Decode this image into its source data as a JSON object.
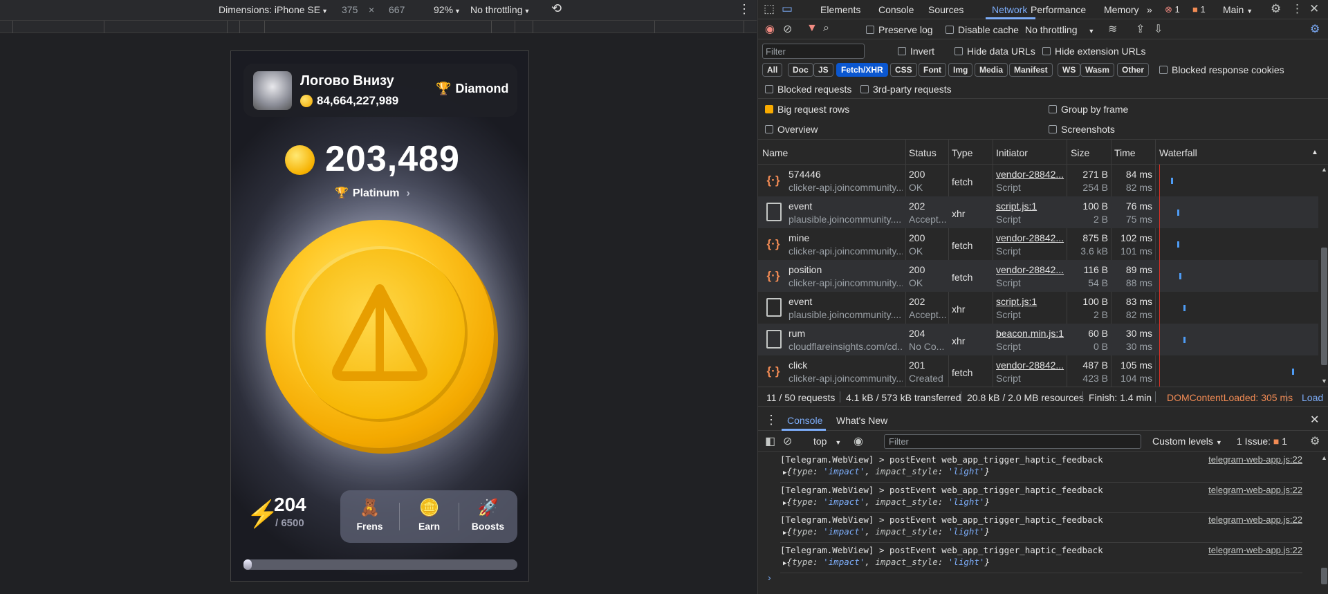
{
  "device_toolbar": {
    "dimensions_label": "Dimensions: iPhone SE",
    "width": "375",
    "times": "×",
    "height": "667",
    "zoom": "92%",
    "throttling": "No throttling"
  },
  "app": {
    "username": "Логово Внизу",
    "balance": "84,664,227,989",
    "tier": "Diamond",
    "score": "203,489",
    "league": "Platinum",
    "energy_current": "204",
    "energy_max": "/ 6500",
    "energy_fraction": 0.031,
    "nav": [
      {
        "label": "Frens",
        "icon": "🧸"
      },
      {
        "label": "Earn",
        "icon": "🪙"
      },
      {
        "label": "Boosts",
        "icon": "🚀"
      }
    ]
  },
  "devtools": {
    "tabs": [
      "Elements",
      "Console",
      "Sources",
      "Network",
      "Performance",
      "Memory"
    ],
    "active_tab": "Network",
    "more": "»",
    "errors": "1",
    "warnings": "1",
    "context": "Main",
    "network_toolbar": {
      "preserve_log": "Preserve log",
      "disable_cache": "Disable cache",
      "throttling": "No throttling"
    },
    "filter": {
      "placeholder": "Filter",
      "invert": "Invert",
      "hide_data_urls": "Hide data URLs",
      "hide_extension_urls": "Hide extension URLs",
      "chips": [
        "All",
        "Doc",
        "JS",
        "Fetch/XHR",
        "CSS",
        "Font",
        "Img",
        "Media",
        "Manifest",
        "WS",
        "Wasm",
        "Other"
      ],
      "active_chip": "Fetch/XHR",
      "blocked_cookies": "Blocked response cookies",
      "blocked_requests": "Blocked requests",
      "third_party": "3rd-party requests",
      "big_rows": "Big request rows",
      "group_by_frame": "Group by frame",
      "overview": "Overview",
      "screenshots": "Screenshots"
    },
    "columns": [
      "Name",
      "Status",
      "Type",
      "Initiator",
      "Size",
      "Time",
      "Waterfall"
    ],
    "rows": [
      {
        "name": "574446",
        "host": "clicker-api.joincommunity...",
        "status": "200",
        "status_text": "OK",
        "type": "fetch",
        "initiator": "vendor-28842...",
        "init_type": "Script",
        "size": "271 B",
        "size2": "254 B",
        "time": "84 ms",
        "time2": "82 ms",
        "icon": "fetch"
      },
      {
        "name": "event",
        "host": "plausible.joincommunity....",
        "status": "202",
        "status_text": "Accept...",
        "type": "xhr",
        "initiator": "script.js:1",
        "init_type": "Script",
        "size": "100 B",
        "size2": "2 B",
        "time": "76 ms",
        "time2": "75 ms",
        "icon": "doc"
      },
      {
        "name": "mine",
        "host": "clicker-api.joincommunity...",
        "status": "200",
        "status_text": "OK",
        "type": "fetch",
        "initiator": "vendor-28842...",
        "init_type": "Script",
        "size": "875 B",
        "size2": "3.6 kB",
        "time": "102 ms",
        "time2": "101 ms",
        "icon": "fetch"
      },
      {
        "name": "position",
        "host": "clicker-api.joincommunity...",
        "status": "200",
        "status_text": "OK",
        "type": "fetch",
        "initiator": "vendor-28842...",
        "init_type": "Script",
        "size": "116 B",
        "size2": "54 B",
        "time": "89 ms",
        "time2": "88 ms",
        "icon": "fetch"
      },
      {
        "name": "event",
        "host": "plausible.joincommunity....",
        "status": "202",
        "status_text": "Accept...",
        "type": "xhr",
        "initiator": "script.js:1",
        "init_type": "Script",
        "size": "100 B",
        "size2": "2 B",
        "time": "83 ms",
        "time2": "82 ms",
        "icon": "doc"
      },
      {
        "name": "rum",
        "host": "cloudflareinsights.com/cd...",
        "status": "204",
        "status_text": "No Co...",
        "type": "xhr",
        "initiator": "beacon.min.js:1",
        "init_type": "Script",
        "size": "60 B",
        "size2": "0 B",
        "time": "30 ms",
        "time2": "30 ms",
        "icon": "doc"
      },
      {
        "name": "click",
        "host": "clicker-api.joincommunity...",
        "status": "201",
        "status_text": "Created",
        "type": "fetch",
        "initiator": "vendor-28842...",
        "init_type": "Script",
        "size": "487 B",
        "size2": "423 B",
        "time": "105 ms",
        "time2": "104 ms",
        "icon": "fetch"
      }
    ],
    "summary": {
      "requests": "11 / 50 requests",
      "transferred": "4.1 kB / 573 kB transferred",
      "resources": "20.8 kB / 2.0 MB resources",
      "finish": "Finish: 1.4 min",
      "dcl": "DOMContentLoaded: 305 ms",
      "load": "Load"
    },
    "drawer": {
      "tabs": [
        "Console",
        "What's New"
      ],
      "context": "top",
      "filter_placeholder": "Filter",
      "levels": "Custom levels",
      "issues_label": "1 Issue:",
      "issues_count": "1"
    },
    "console_messages": [
      {
        "text": "[Telegram.WebView] > postEvent web_app_trigger_haptic_feedback",
        "obj_type": "'impact'",
        "obj_style": "'light'",
        "source": "telegram-web-app.js:22"
      },
      {
        "text": "[Telegram.WebView] > postEvent web_app_trigger_haptic_feedback",
        "obj_type": "'impact'",
        "obj_style": "'light'",
        "source": "telegram-web-app.js:22"
      },
      {
        "text": "[Telegram.WebView] > postEvent web_app_trigger_haptic_feedback",
        "obj_type": "'impact'",
        "obj_style": "'light'",
        "source": "telegram-web-app.js:22"
      },
      {
        "text": "[Telegram.WebView] > postEvent web_app_trigger_haptic_feedback",
        "obj_type": "'impact'",
        "obj_style": "'light'",
        "source": "telegram-web-app.js:22"
      }
    ],
    "console_key_type": "type",
    "console_key_style": "impact_style",
    "prompt": "›"
  }
}
